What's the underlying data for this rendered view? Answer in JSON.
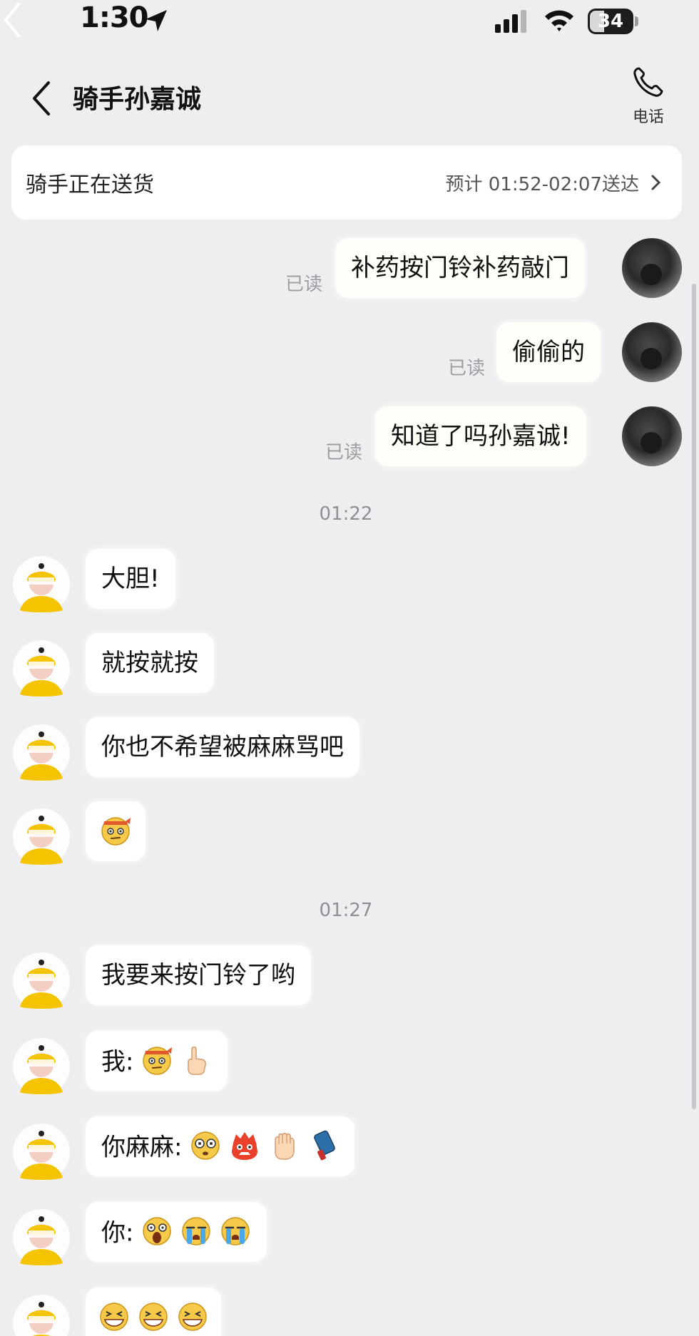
{
  "status_bar": {
    "time": "1:30",
    "battery": "34"
  },
  "header": {
    "title": "骑手孙嘉诚",
    "phone_label": "电话"
  },
  "banner": {
    "status": "骑手正在送货",
    "eta": "预计 01:52-02:07送达"
  },
  "messages": {
    "outgoing": [
      {
        "text": "补药按门铃补药敲门",
        "read": "已读"
      },
      {
        "text": "偷偷的",
        "read": "已读"
      },
      {
        "text": "知道了吗孙嘉诚!",
        "read": "已读"
      }
    ],
    "timestamp_1": "01:22",
    "group_1": [
      {
        "text": "大胆!"
      },
      {
        "text": "就按就按"
      },
      {
        "text": "你也不希望被麻麻骂吧"
      }
    ],
    "timestamp_2": "01:27",
    "group_2": [
      {
        "text": "我要来按门铃了哟"
      },
      {
        "text": "我:"
      },
      {
        "text": "你麻麻:"
      },
      {
        "text": "你:"
      }
    ]
  },
  "emoji": {
    "m7": "determined-face",
    "m9a": "determined-face",
    "m9b": "pointing-hand",
    "m10a": "shocked-face",
    "m10b": "angry-red-face",
    "m10c": "fist",
    "m10d": "phone",
    "m11a": "screaming-face",
    "m11b": "crying-face",
    "m11c": "crying-face",
    "m12": "grinning-face"
  },
  "colors": {
    "background": "#eeeef0",
    "bubble": "#ffffff",
    "rider_accent": "#f5c400",
    "read_text": "#9d9da2"
  }
}
